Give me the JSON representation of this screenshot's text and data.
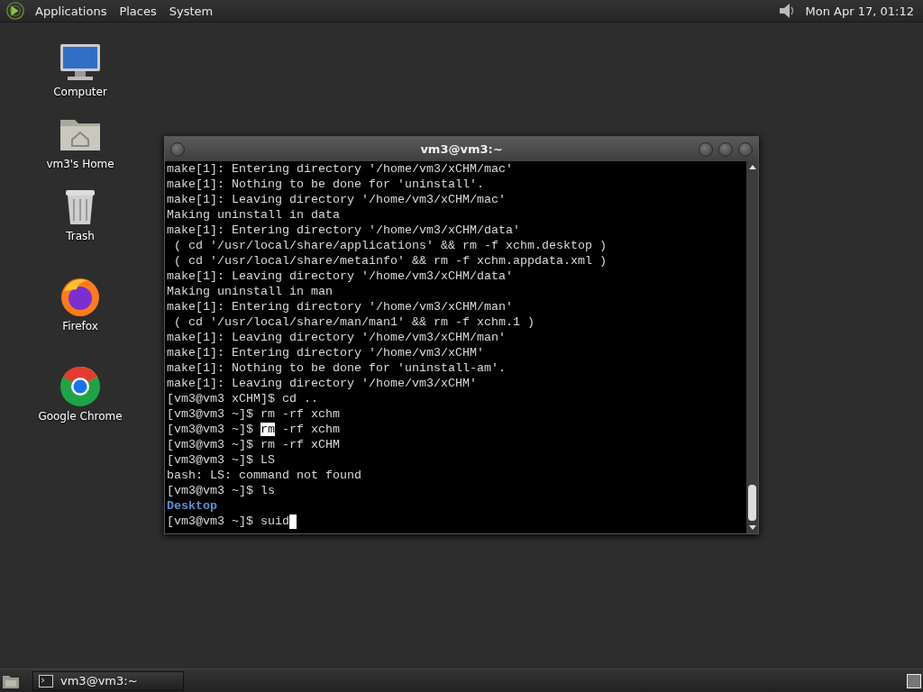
{
  "top_panel": {
    "menus": [
      "Applications",
      "Places",
      "System"
    ],
    "clock": "Mon Apr 17, 01:12"
  },
  "desktop_icons": [
    {
      "label": "Computer",
      "kind": "computer"
    },
    {
      "label": "vm3's Home",
      "kind": "home"
    },
    {
      "label": "Trash",
      "kind": "trash"
    },
    {
      "label": "Firefox",
      "kind": "firefox"
    },
    {
      "label": "Google Chrome",
      "kind": "chrome"
    }
  ],
  "terminal": {
    "title": "vm3@vm3:~",
    "lines": [
      {
        "kind": "text",
        "text": "make[1]: Entering directory '/home/vm3/xCHM/mac'"
      },
      {
        "kind": "text",
        "text": "make[1]: Nothing to be done for 'uninstall'."
      },
      {
        "kind": "text",
        "text": "make[1]: Leaving directory '/home/vm3/xCHM/mac'"
      },
      {
        "kind": "text",
        "text": "Making uninstall in data"
      },
      {
        "kind": "text",
        "text": "make[1]: Entering directory '/home/vm3/xCHM/data'"
      },
      {
        "kind": "text",
        "text": " ( cd '/usr/local/share/applications' && rm -f xchm.desktop )"
      },
      {
        "kind": "text",
        "text": " ( cd '/usr/local/share/metainfo' && rm -f xchm.appdata.xml )"
      },
      {
        "kind": "text",
        "text": "make[1]: Leaving directory '/home/vm3/xCHM/data'"
      },
      {
        "kind": "text",
        "text": "Making uninstall in man"
      },
      {
        "kind": "text",
        "text": "make[1]: Entering directory '/home/vm3/xCHM/man'"
      },
      {
        "kind": "text",
        "text": " ( cd '/usr/local/share/man/man1' && rm -f xchm.1 )"
      },
      {
        "kind": "text",
        "text": "make[1]: Leaving directory '/home/vm3/xCHM/man'"
      },
      {
        "kind": "text",
        "text": "make[1]: Entering directory '/home/vm3/xCHM'"
      },
      {
        "kind": "text",
        "text": "make[1]: Nothing to be done for 'uninstall-am'."
      },
      {
        "kind": "text",
        "text": "make[1]: Leaving directory '/home/vm3/xCHM'"
      },
      {
        "kind": "text",
        "text": "[vm3@vm3 xCHM]$ cd .."
      },
      {
        "kind": "text",
        "text": "[vm3@vm3 ~]$ rm -rf xchm"
      },
      {
        "kind": "selection",
        "before": "[vm3@vm3 ~]$ ",
        "selected": "rm",
        "after": " -rf xchm"
      },
      {
        "kind": "text",
        "text": "[vm3@vm3 ~]$ rm -rf xCHM"
      },
      {
        "kind": "text",
        "text": "[vm3@vm3 ~]$ LS"
      },
      {
        "kind": "text",
        "text": "bash: LS: command not found"
      },
      {
        "kind": "text",
        "text": "[vm3@vm3 ~]$ ls"
      },
      {
        "kind": "dir",
        "text": "Desktop"
      },
      {
        "kind": "input",
        "text": "[vm3@vm3 ~]$ suid"
      }
    ]
  },
  "taskbar": {
    "tasks": [
      {
        "label": "vm3@vm3:~",
        "selected": false
      }
    ]
  }
}
